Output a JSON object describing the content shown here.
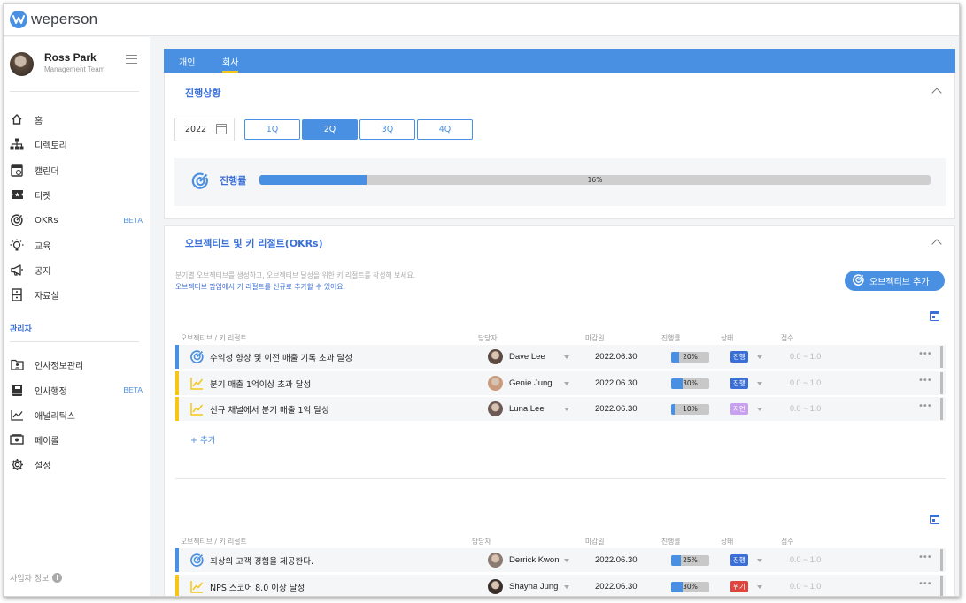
{
  "app": {
    "brand": "weperson",
    "accent": "#4a90e2"
  },
  "profile": {
    "name": "Ross Park",
    "team": "Management Team"
  },
  "nav": [
    {
      "label": "홈",
      "icon": "home-icon"
    },
    {
      "label": "디렉토리",
      "icon": "org-chart-icon"
    },
    {
      "label": "캘린더",
      "icon": "calendar-icon"
    },
    {
      "label": "티켓",
      "icon": "ticket-icon"
    },
    {
      "label": "OKRs",
      "icon": "target-icon",
      "badge": "BETA"
    },
    {
      "label": "교육",
      "icon": "lightbulb-icon"
    },
    {
      "label": "공지",
      "icon": "megaphone-icon"
    },
    {
      "label": "자료실",
      "icon": "archive-icon"
    }
  ],
  "admin": {
    "label": "관리자",
    "items": [
      {
        "label": "인사정보관리",
        "icon": "folder-person-icon"
      },
      {
        "label": "인사행정",
        "icon": "book-icon",
        "badge": "BETA"
      },
      {
        "label": "애널리틱스",
        "icon": "line-chart-icon"
      },
      {
        "label": "페이롤",
        "icon": "money-icon"
      },
      {
        "label": "설정",
        "icon": "gear-icon"
      }
    ]
  },
  "footer": {
    "biz_info": "사업자 정보"
  },
  "tabs": [
    "개인",
    "회사"
  ],
  "active_tab": "회사",
  "progress": {
    "title": "진행상황",
    "year": "2022",
    "quarters": [
      "1Q",
      "2Q",
      "3Q",
      "4Q"
    ],
    "selected_quarter": "2Q",
    "label": "진행률",
    "value_text": "16%",
    "value": 0.16
  },
  "okrs": {
    "title": "오브젝티브 및 키 리절트(OKRs)",
    "desc1": "분기별 오브젝티브를 생성하고, 오브젝티브 달성을 위한 키 리절트를 작성해 보세요.",
    "desc2": "오브젝티브 팝업에서 키 리절트를 신규로 추가할 수 있어요.",
    "add_button": "오브젝티브 추가",
    "columns": [
      "오브젝티브 / 키 리절트",
      "담당자",
      "마감일",
      "진행률",
      "상태",
      "점수"
    ],
    "add_row": "+ 추가",
    "groups": [
      {
        "rows": [
          {
            "title": "수익성 향상 및 이전 매출 기록 초과 달성",
            "kind": "objective",
            "owner": "Dave Lee",
            "due": "2022.06.30",
            "progress": "20%",
            "pct": 0.2,
            "status": "진행",
            "status_color": "#3a6fd8",
            "score": "0.0 ~ 1.0",
            "bar_color": "#4a90e2"
          },
          {
            "title": "분기 매출 1억이상 초과 달성",
            "kind": "key-result",
            "owner": "Genie Jung",
            "due": "2022.06.30",
            "progress": "30%",
            "pct": 0.3,
            "status": "진행",
            "status_color": "#3a6fd8",
            "score": "0.0 ~ 1.0",
            "bar_color": "#f5c518"
          },
          {
            "title": "신규 채널에서 분기 매출 1억 달성",
            "kind": "key-result",
            "owner": "Luna Lee",
            "due": "2022.06.30",
            "progress": "10%",
            "pct": 0.1,
            "status": "지연",
            "status_color": "#c9a0f0",
            "score": "0.0 ~ 1.0",
            "bar_color": "#f5c518"
          }
        ]
      },
      {
        "rows": [
          {
            "title": "최상의 고객 경험을 제공한다.",
            "kind": "objective",
            "owner": "Derrick Kwon",
            "due": "2022.06.30",
            "progress": "25%",
            "pct": 0.25,
            "status": "진행",
            "status_color": "#3a6fd8",
            "score": "0.0 ~ 1.0",
            "bar_color": "#4a90e2"
          },
          {
            "title": "NPS 스코어 8.0 이상 달성",
            "kind": "key-result",
            "owner": "Shayna Jung",
            "due": "2022.06.30",
            "progress": "30%",
            "pct": 0.3,
            "status": "위기",
            "status_color": "#e0443e",
            "score": "0.0 ~ 1.0",
            "bar_color": "#f5c518"
          }
        ]
      }
    ]
  }
}
